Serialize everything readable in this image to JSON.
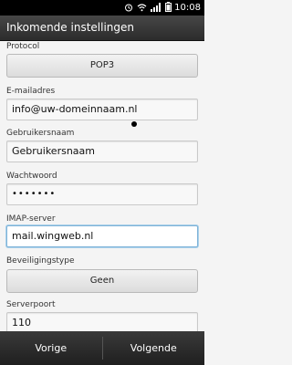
{
  "statusbar": {
    "time": "10:08",
    "icons": [
      "alarm-icon",
      "wifi-icon",
      "signal-icon",
      "battery-icon"
    ]
  },
  "titlebar": {
    "title": "Inkomende instellingen"
  },
  "form": {
    "protocol": {
      "label": "Protocol",
      "value": "POP3"
    },
    "email": {
      "label": "E-mailadres",
      "value": "info@uw-domeinnaam.nl"
    },
    "username": {
      "label": "Gebruikersnaam",
      "value": "Gebruikersnaam"
    },
    "password": {
      "label": "Wachtwoord",
      "value": "•••••••"
    },
    "imap_server": {
      "label": "IMAP-server",
      "value": "mail.wingweb.nl"
    },
    "security": {
      "label": "Beveiligingstype",
      "value": "Geen"
    },
    "port": {
      "label": "Serverpoort",
      "value": "110"
    }
  },
  "bottombar": {
    "prev_label": "Vorige",
    "next_label": "Volgende"
  },
  "colors": {
    "focus": "#7fb3d8",
    "titlebar": "#3a3a3a",
    "background": "#f4f4f4"
  }
}
